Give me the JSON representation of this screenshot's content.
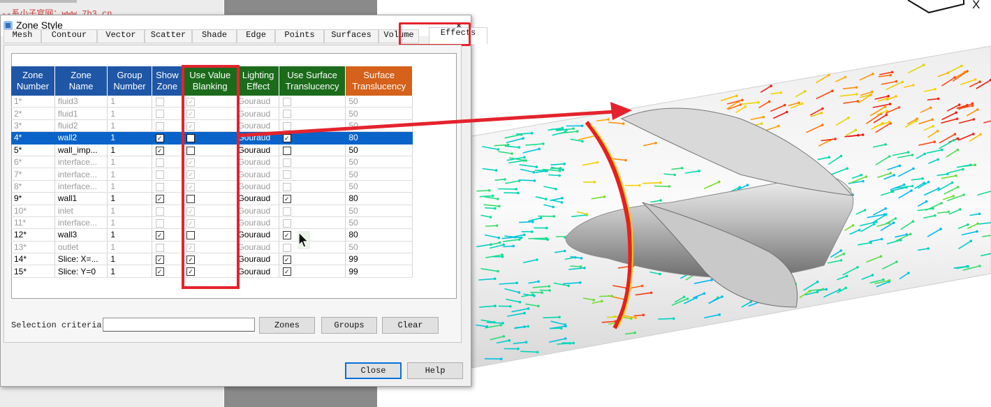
{
  "watermark": "--系小子官网：www.7b3.cn",
  "viewer": {
    "axis_label": "X"
  },
  "dialog": {
    "title": "Zone Style",
    "close_glyph": "×",
    "tabs": [
      "Mesh",
      "Contour",
      "Vector",
      "Scatter",
      "Shade",
      "Edge",
      "Points",
      "Surfaces",
      "Volume",
      "Effects"
    ],
    "active_tab": "Effects",
    "columns": [
      {
        "label": "Zone\nNumber",
        "color": "#1f56a6"
      },
      {
        "label": "Zone\nName",
        "color": "#1f56a6"
      },
      {
        "label": "Group\nNumber",
        "color": "#1f56a6"
      },
      {
        "label": "Show\nZone",
        "color": "#1f56a6"
      },
      {
        "label": "Use Value\nBlanking",
        "color": "#1b6b1b"
      },
      {
        "label": "Lighting\nEffect",
        "color": "#1b6b1b"
      },
      {
        "label": "Use Surface\nTranslucency",
        "color": "#1b6b1b"
      },
      {
        "label": "Surface\nTranslucency",
        "color": "#d5611a"
      }
    ],
    "rows": [
      {
        "num": "1*",
        "name": "fluid3",
        "group": "1",
        "show": false,
        "blank": true,
        "light": "Gouraud",
        "use_trans": false,
        "trans": "50",
        "state": "dim"
      },
      {
        "num": "2*",
        "name": "fluid1",
        "group": "1",
        "show": false,
        "blank": true,
        "light": "Gouraud",
        "use_trans": false,
        "trans": "50",
        "state": "dim"
      },
      {
        "num": "3*",
        "name": "fluid2",
        "group": "1",
        "show": false,
        "blank": true,
        "light": "Gouraud",
        "use_trans": false,
        "trans": "50",
        "state": "dim"
      },
      {
        "num": "4*",
        "name": "wall2",
        "group": "1",
        "show": true,
        "blank": false,
        "light": "Gouraud",
        "use_trans": true,
        "trans": "80",
        "state": "selected"
      },
      {
        "num": "5*",
        "name": "wall_imp...",
        "group": "1",
        "show": true,
        "blank": false,
        "light": "Gouraud",
        "use_trans": false,
        "trans": "50",
        "state": "on"
      },
      {
        "num": "6*",
        "name": "interface...",
        "group": "1",
        "show": false,
        "blank": true,
        "light": "Gouraud",
        "use_trans": false,
        "trans": "50",
        "state": "dim"
      },
      {
        "num": "7*",
        "name": "interface...",
        "group": "1",
        "show": false,
        "blank": true,
        "light": "Gouraud",
        "use_trans": false,
        "trans": "50",
        "state": "dim"
      },
      {
        "num": "8*",
        "name": "interface...",
        "group": "1",
        "show": false,
        "blank": true,
        "light": "Gouraud",
        "use_trans": false,
        "trans": "50",
        "state": "dim"
      },
      {
        "num": "9*",
        "name": "wall1",
        "group": "1",
        "show": true,
        "blank": false,
        "light": "Gouraud",
        "use_trans": true,
        "trans": "80",
        "state": "on"
      },
      {
        "num": "10*",
        "name": "inlet",
        "group": "1",
        "show": false,
        "blank": true,
        "light": "Gouraud",
        "use_trans": false,
        "trans": "50",
        "state": "dim"
      },
      {
        "num": "11*",
        "name": "interface...",
        "group": "1",
        "show": false,
        "blank": true,
        "light": "Gouraud",
        "use_trans": false,
        "trans": "50",
        "state": "dim"
      },
      {
        "num": "12*",
        "name": "wall3",
        "group": "1",
        "show": true,
        "blank": false,
        "light": "Gouraud",
        "use_trans": true,
        "trans": "80",
        "state": "on"
      },
      {
        "num": "13*",
        "name": "outlet",
        "group": "1",
        "show": false,
        "blank": true,
        "light": "Gouraud",
        "use_trans": false,
        "trans": "50",
        "state": "dim"
      },
      {
        "num": "14*",
        "name": "Slice: X=...",
        "group": "1",
        "show": true,
        "blank": true,
        "light": "Gouraud",
        "use_trans": true,
        "trans": "99",
        "state": "on"
      },
      {
        "num": "15*",
        "name": "Slice: Y=0",
        "group": "1",
        "show": true,
        "blank": true,
        "light": "Gouraud",
        "use_trans": true,
        "trans": "99",
        "state": "on"
      }
    ],
    "selection_label": "Selection criteria:",
    "selection_value": "",
    "zones_btn": "Zones",
    "groups_btn": "Groups",
    "clear_btn": "Clear",
    "close_btn": "Close",
    "help_btn": "Help"
  },
  "annotation_color": "#e4232d"
}
